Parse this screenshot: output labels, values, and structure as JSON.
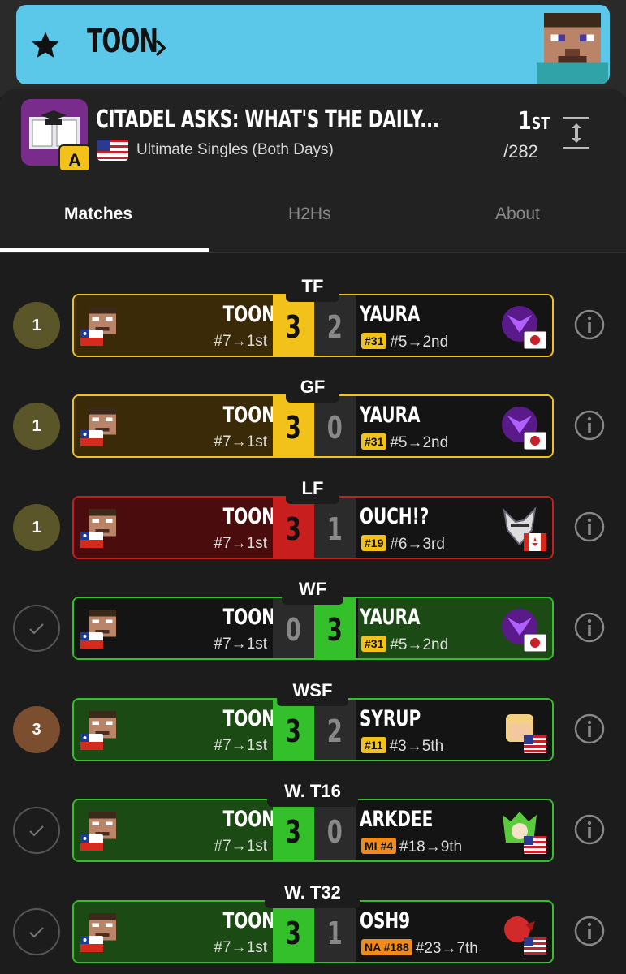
{
  "banner": {
    "player": "TOON"
  },
  "event": {
    "title": "CITADEL ASKS: WHAT'S THE DAILY...",
    "tier": "A",
    "subtitle": "Ultimate Singles (Both Days)",
    "placing": "1",
    "placing_suffix": "ST",
    "entrants": "/282"
  },
  "tabs": [
    {
      "label": "Matches"
    },
    {
      "label": "H2Hs"
    },
    {
      "label": "About"
    }
  ],
  "matches": [
    {
      "round": "TF",
      "seed": "1",
      "seed_style": "gold",
      "status": "loss",
      "p1": "TOON",
      "p1_info": "#7→1st",
      "s1": "3",
      "s2": "2",
      "p2": "YAURA",
      "p2_badge": "#31",
      "p2_info": "#5→2nd"
    },
    {
      "round": "GF",
      "seed": "1",
      "seed_style": "gold",
      "status": "loss",
      "p1": "TOON",
      "p1_info": "#7→1st",
      "s1": "3",
      "s2": "0",
      "p2": "YAURA",
      "p2_badge": "#31",
      "p2_info": "#5→2nd"
    },
    {
      "round": "LF",
      "seed": "1",
      "seed_style": "gold",
      "status": "red",
      "p1": "TOON",
      "p1_info": "#7→1st",
      "s1": "3",
      "s2": "1",
      "p2": "OUCH!?",
      "p2_badge": "#19",
      "p2_info": "#6→3rd"
    },
    {
      "round": "WF",
      "seed": "",
      "seed_style": "check",
      "status": "lost",
      "p1": "TOON",
      "p1_info": "#7→1st",
      "s1": "0",
      "s2": "3",
      "p2": "YAURA",
      "p2_badge": "#31",
      "p2_info": "#5→2nd"
    },
    {
      "round": "WSF",
      "seed": "3",
      "seed_style": "bronze",
      "status": "win",
      "p1": "TOON",
      "p1_info": "#7→1st",
      "s1": "3",
      "s2": "2",
      "p2": "SYRUP",
      "p2_badge": "#11",
      "p2_info": "#3→5th"
    },
    {
      "round": "W. T16",
      "seed": "",
      "seed_style": "check",
      "status": "win",
      "p1": "TOON",
      "p1_info": "#7→1st",
      "s1": "3",
      "s2": "0",
      "p2": "ARKDEE",
      "p2_badge": "MI #4",
      "p2_info": "#18→9th"
    },
    {
      "round": "W. T32",
      "seed": "",
      "seed_style": "check",
      "status": "win",
      "p1": "TOON",
      "p1_info": "#7→1st",
      "s1": "3",
      "s2": "1",
      "p2": "OSH9",
      "p2_badge": "NA #188",
      "p2_info": "#23→7th"
    }
  ],
  "colors": {
    "banner": "#5bc8ea",
    "gold": "#f3c21a",
    "win_green": "#33c02a",
    "loss_red": "#c81e1e"
  }
}
